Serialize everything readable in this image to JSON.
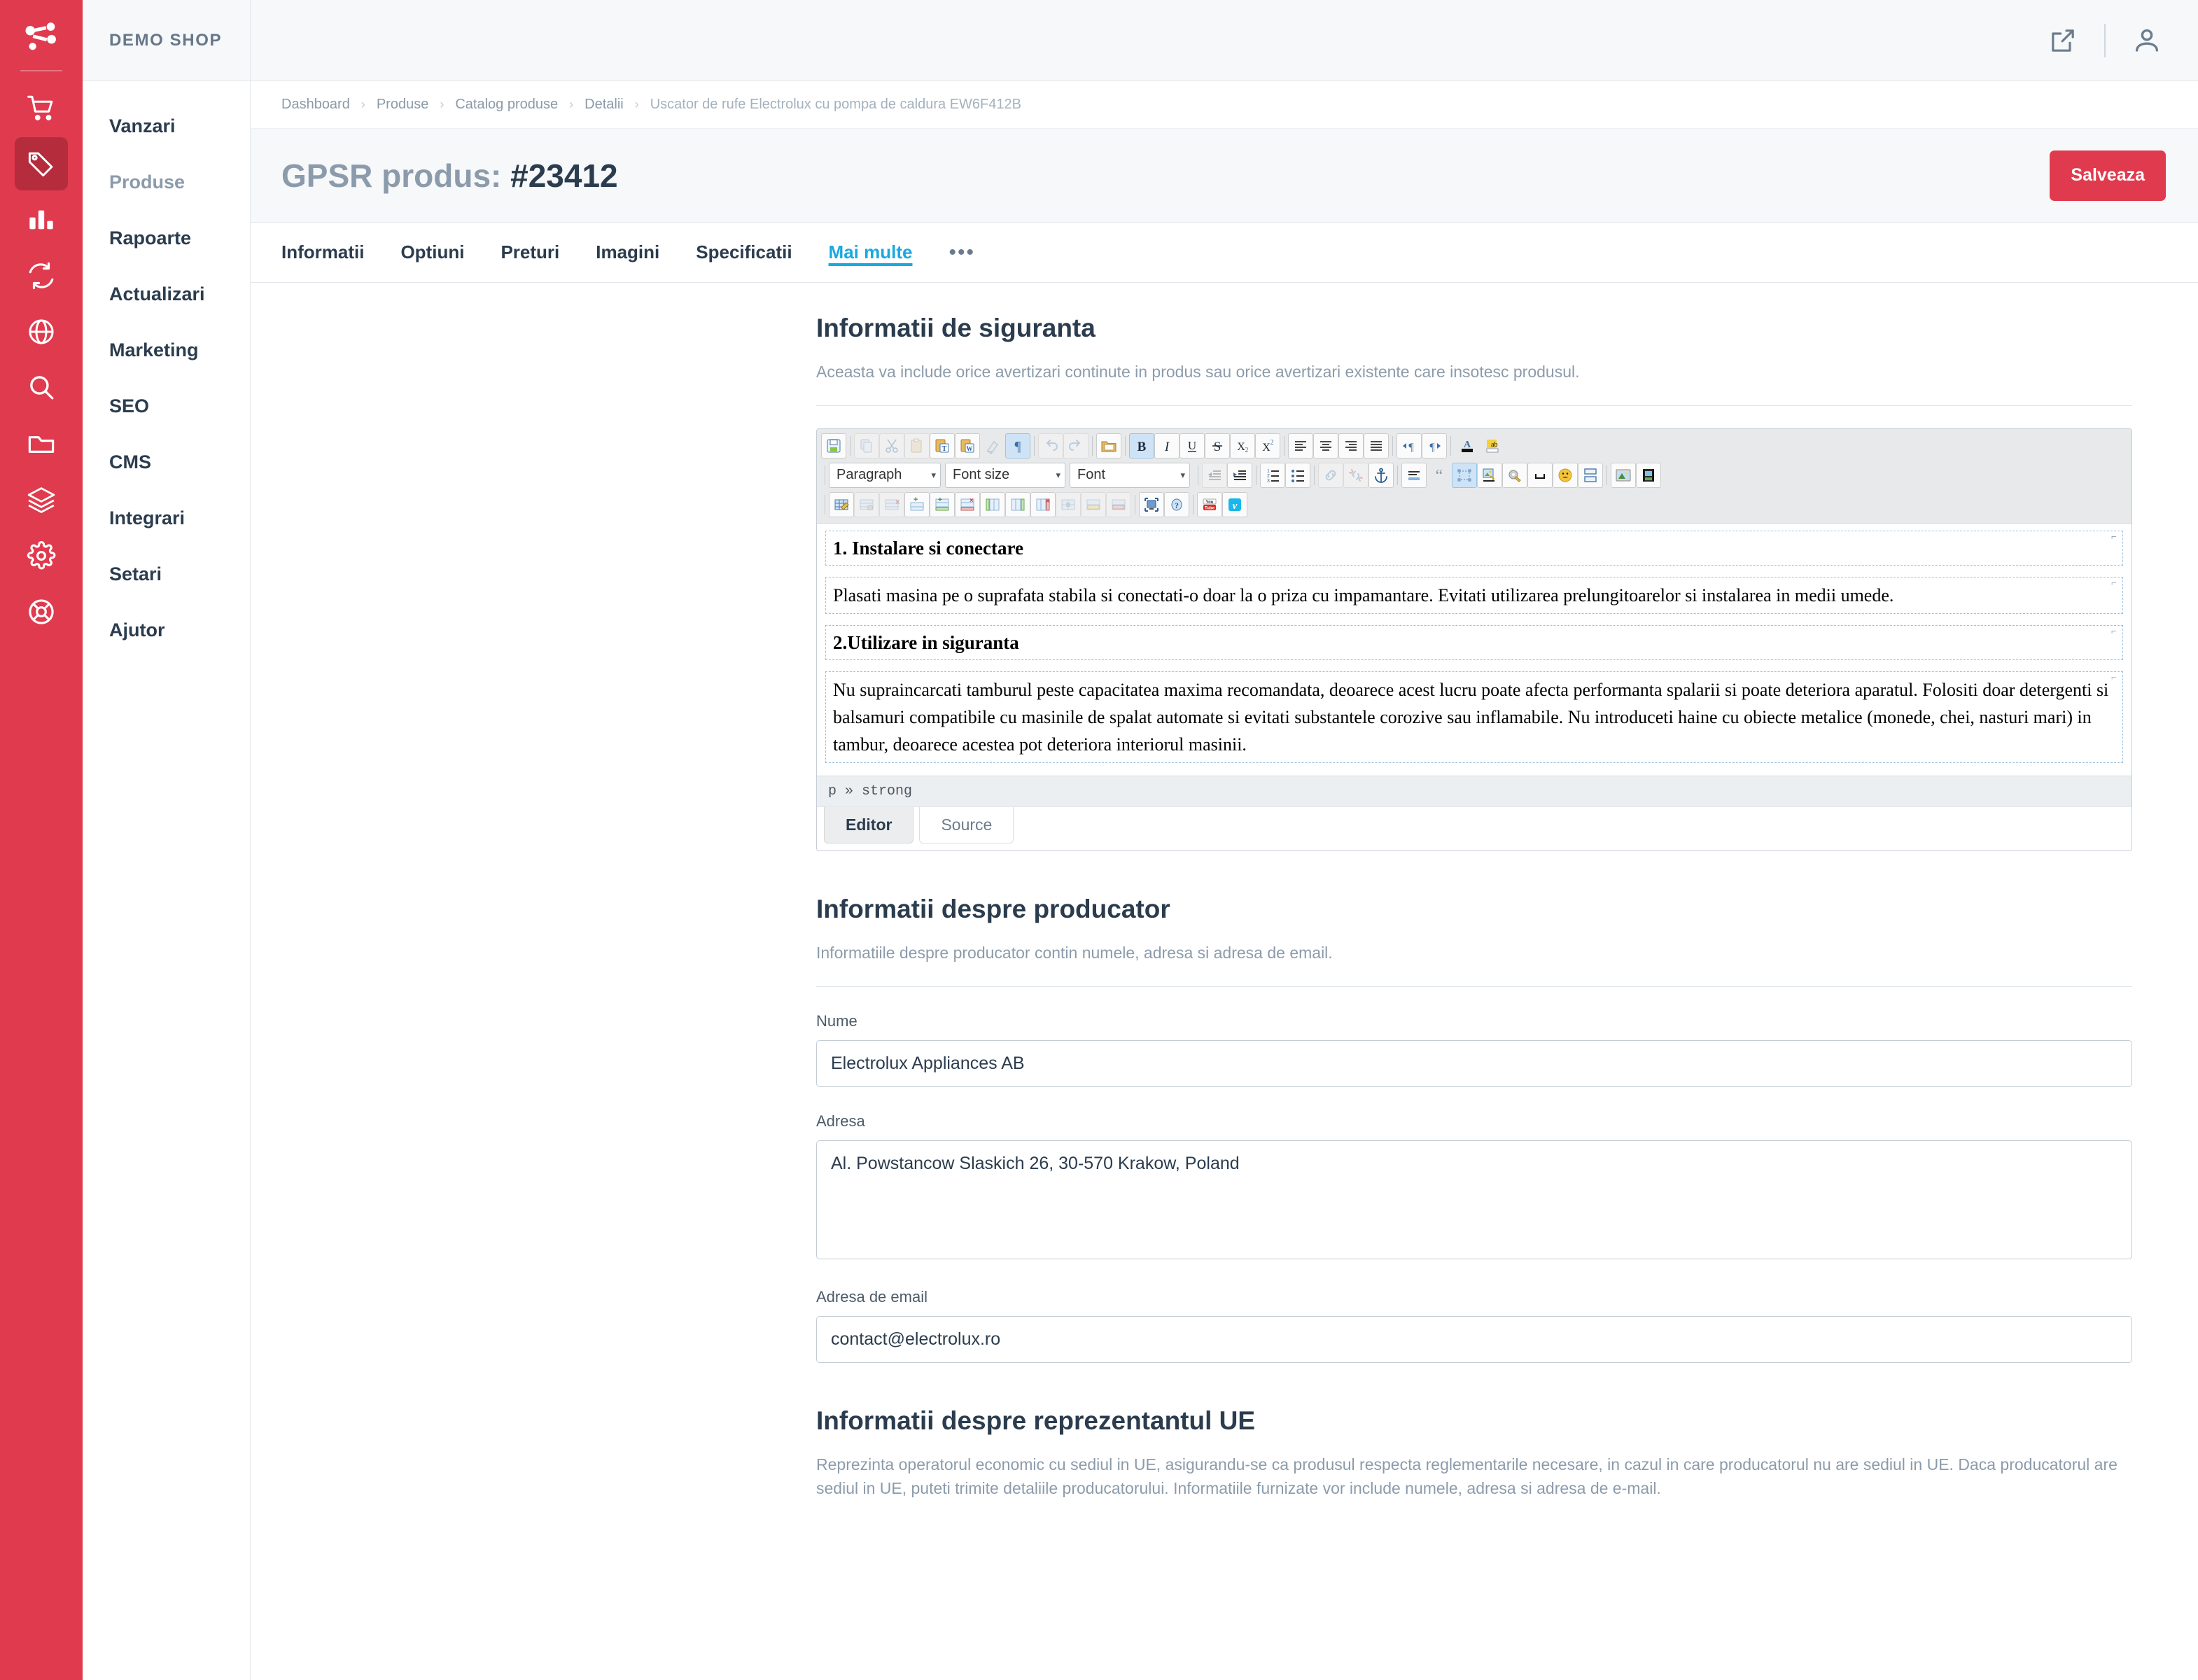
{
  "brand": {
    "name": "DEMO SHOP",
    "logo_icon": "network-nodes-icon"
  },
  "rail": {
    "items": [
      {
        "icon": "cart-icon",
        "name": "rail-item-sales",
        "active": false
      },
      {
        "icon": "tag-icon",
        "name": "rail-item-products",
        "active": true
      },
      {
        "icon": "bar-chart-icon",
        "name": "rail-item-reports",
        "active": false
      },
      {
        "icon": "refresh-icon",
        "name": "rail-item-updates",
        "active": false
      },
      {
        "icon": "globe-icon",
        "name": "rail-item-marketing",
        "active": false
      },
      {
        "icon": "search-icon",
        "name": "rail-item-seo",
        "active": false
      },
      {
        "icon": "folder-icon",
        "name": "rail-item-cms",
        "active": false
      },
      {
        "icon": "layers-icon",
        "name": "rail-item-integrations",
        "active": false
      },
      {
        "icon": "gear-icon",
        "name": "rail-item-settings",
        "active": false
      },
      {
        "icon": "lifebuoy-icon",
        "name": "rail-item-help",
        "active": false
      }
    ]
  },
  "sidebar": {
    "items": [
      {
        "label": "Vanzari",
        "muted": false
      },
      {
        "label": "Produse",
        "muted": true
      },
      {
        "label": "Rapoarte",
        "muted": false
      },
      {
        "label": "Actualizari",
        "muted": false
      },
      {
        "label": "Marketing",
        "muted": false
      },
      {
        "label": "SEO",
        "muted": false
      },
      {
        "label": "CMS",
        "muted": false
      },
      {
        "label": "Integrari",
        "muted": false
      },
      {
        "label": "Setari",
        "muted": false
      },
      {
        "label": "Ajutor",
        "muted": false
      }
    ]
  },
  "topbar": {
    "external_link_icon": "external-link-icon",
    "account_icon": "user-account-icon"
  },
  "breadcrumb": {
    "separator": "›",
    "items": [
      "Dashboard",
      "Produse",
      "Catalog produse",
      "Detalii",
      "Uscator de rufe Electrolux cu pompa de caldura EW6F412B"
    ]
  },
  "page": {
    "title_prefix": "GPSR produs: ",
    "title_id": "#23412",
    "save_label": "Salveaza",
    "accent_color": "#e03a4e",
    "link_color": "#1aa8e0"
  },
  "tabs": {
    "items": [
      {
        "label": "Informatii",
        "active": false
      },
      {
        "label": "Optiuni",
        "active": false
      },
      {
        "label": "Preturi",
        "active": false
      },
      {
        "label": "Imagini",
        "active": false
      },
      {
        "label": "Specificatii",
        "active": false
      },
      {
        "label": "Mai multe",
        "active": true
      }
    ],
    "overflow": "•••"
  },
  "safety": {
    "heading": "Informatii de siguranta",
    "description": "Aceasta va include orice avertizari continute in produs sau orice avertizari existente care insotesc produsul."
  },
  "editor": {
    "combo_paragraph": "Paragraph",
    "combo_fontsize": "Font size",
    "combo_font": "Font",
    "combo_arrow": "▾",
    "row1_icons": [
      "save-icon",
      "copy-icon",
      "cut-icon",
      "paste-icon",
      "paste-text-icon",
      "paste-word-icon",
      "remove-format-icon",
      "show-blocks-icon",
      "undo-icon",
      "redo-icon",
      "templates-icon",
      "bold-icon",
      "italic-icon",
      "underline-icon",
      "strikethrough-icon",
      "subscript-icon",
      "superscript-icon",
      "align-left-icon",
      "align-center-icon",
      "align-right-icon",
      "justify-icon",
      "ltr-icon",
      "rtl-icon",
      "text-color-icon",
      "background-color-icon"
    ],
    "row2_icons": [
      "outdent-icon",
      "indent-icon",
      "numbered-list-icon",
      "bulleted-list-icon",
      "link-icon",
      "unlink-icon",
      "anchor-icon",
      "horizontal-rule-icon",
      "blockquote-icon",
      "div-container-icon",
      "image-icon",
      "flash-icon",
      "special-char-icon",
      "smiley-icon",
      "page-break-icon",
      "media-image-icon",
      "media-video-icon"
    ],
    "row3_icons": [
      "table-icon",
      "table-properties-icon",
      "delete-table-icon",
      "insert-row-before-icon",
      "insert-row-after-icon",
      "delete-row-icon",
      "insert-column-before-icon",
      "insert-column-after-icon",
      "delete-column-icon",
      "merge-cells-icon",
      "split-cell-horizontal-icon",
      "split-cell-vertical-icon",
      "maximize-icon",
      "about-icon",
      "youtube-icon",
      "vimeo-icon"
    ],
    "content": [
      {
        "type": "heading",
        "text": "1. Instalare si conectare"
      },
      {
        "type": "paragraph",
        "text": "Plasati masina pe o suprafata stabila si conectati-o doar la o priza cu impamantare. Evitati utilizarea prelungitoarelor si instalarea in medii umede."
      },
      {
        "type": "heading",
        "text": "2.Utilizare in siguranta"
      },
      {
        "type": "paragraph",
        "text": "Nu supraincarcati tamburul peste capacitatea maxima recomandata, deoarece acest lucru poate afecta performanta spalarii si poate deteriora aparatul. Folositi doar detergenti si balsamuri compatibile cu masinile de spalat automate si evitati substantele corozive sau inflamabile. Nu introduceti haine cu obiecte metalice (monede, chei, nasturi mari) in tambur, deoarece acestea pot deteriora interiorul masinii."
      }
    ],
    "path": "p » strong",
    "tab_editor": "Editor",
    "tab_source": "Source"
  },
  "manufacturer": {
    "heading": "Informatii despre producator",
    "description": "Informatiile despre producator contin numele, adresa si adresa de email.",
    "name_label": "Nume",
    "name_value": "Electrolux Appliances AB",
    "address_label": "Adresa",
    "address_value": "Al. Powstancow Slaskich 26, 30-570 Krakow, Poland",
    "email_label": "Adresa de email",
    "email_value": "contact@electrolux.ro"
  },
  "eu_rep": {
    "heading": "Informatii despre reprezentantul UE",
    "description": "Reprezinta operatorul economic cu sediul in UE, asigurandu-se ca produsul respecta reglementarile necesare, in cazul in care producatorul nu are sediul in UE. Daca producatorul are sediul in UE, puteti trimite detaliile producatorului. Informatiile furnizate vor include numele, adresa si adresa de e-mail."
  }
}
